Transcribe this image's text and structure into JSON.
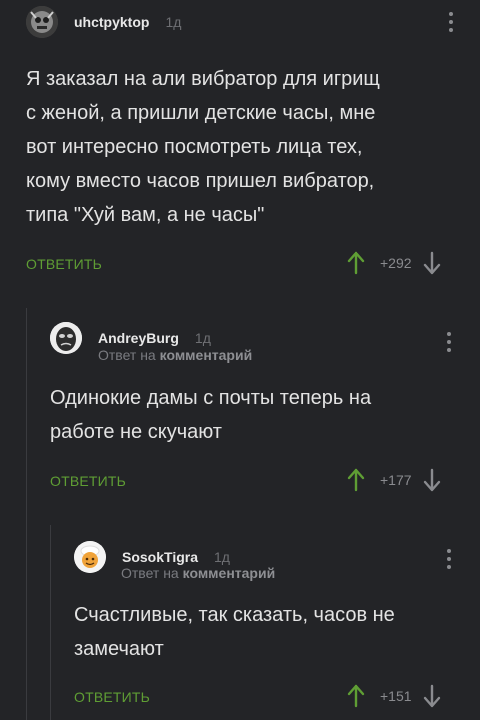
{
  "comments": [
    {
      "user": "uhctpyktop",
      "time": "1д",
      "subtitle_prefix": "",
      "subtitle_link": "",
      "lines": [
        "Я заказал на али вибратор для игрищ",
        "с женой, а пришли детские часы, мне",
        "вот интересно посмотреть лица тех,",
        "кому вместо часов пришел вибратор,",
        "типа \"Хуй вам, а не часы\""
      ],
      "reply_label": "ОТВЕТИТЬ",
      "score": "+292"
    },
    {
      "user": "AndreyBurg",
      "time": "1д",
      "subtitle_prefix": "Ответ на ",
      "subtitle_link": "комментарий",
      "lines": [
        "Одинокие дамы с почты теперь на",
        "работе не скучают"
      ],
      "reply_label": "ОТВЕТИТЬ",
      "score": "+177"
    },
    {
      "user": "SosokTigra",
      "time": "1д",
      "subtitle_prefix": "Ответ на ",
      "subtitle_link": "комментарий",
      "lines": [
        "Счастливые, так сказать, часов не",
        "замечают"
      ],
      "reply_label": "ОТВЕТИТЬ",
      "score": "+151"
    }
  ],
  "colors": {
    "background": "#232427",
    "reply": "#5f9e34",
    "upvote": "#5f9e34",
    "muted": "#8a8b8f"
  },
  "icons": [
    "avatar-image",
    "more-vertical-icon",
    "upvote-arrow-icon",
    "downvote-arrow-icon"
  ]
}
